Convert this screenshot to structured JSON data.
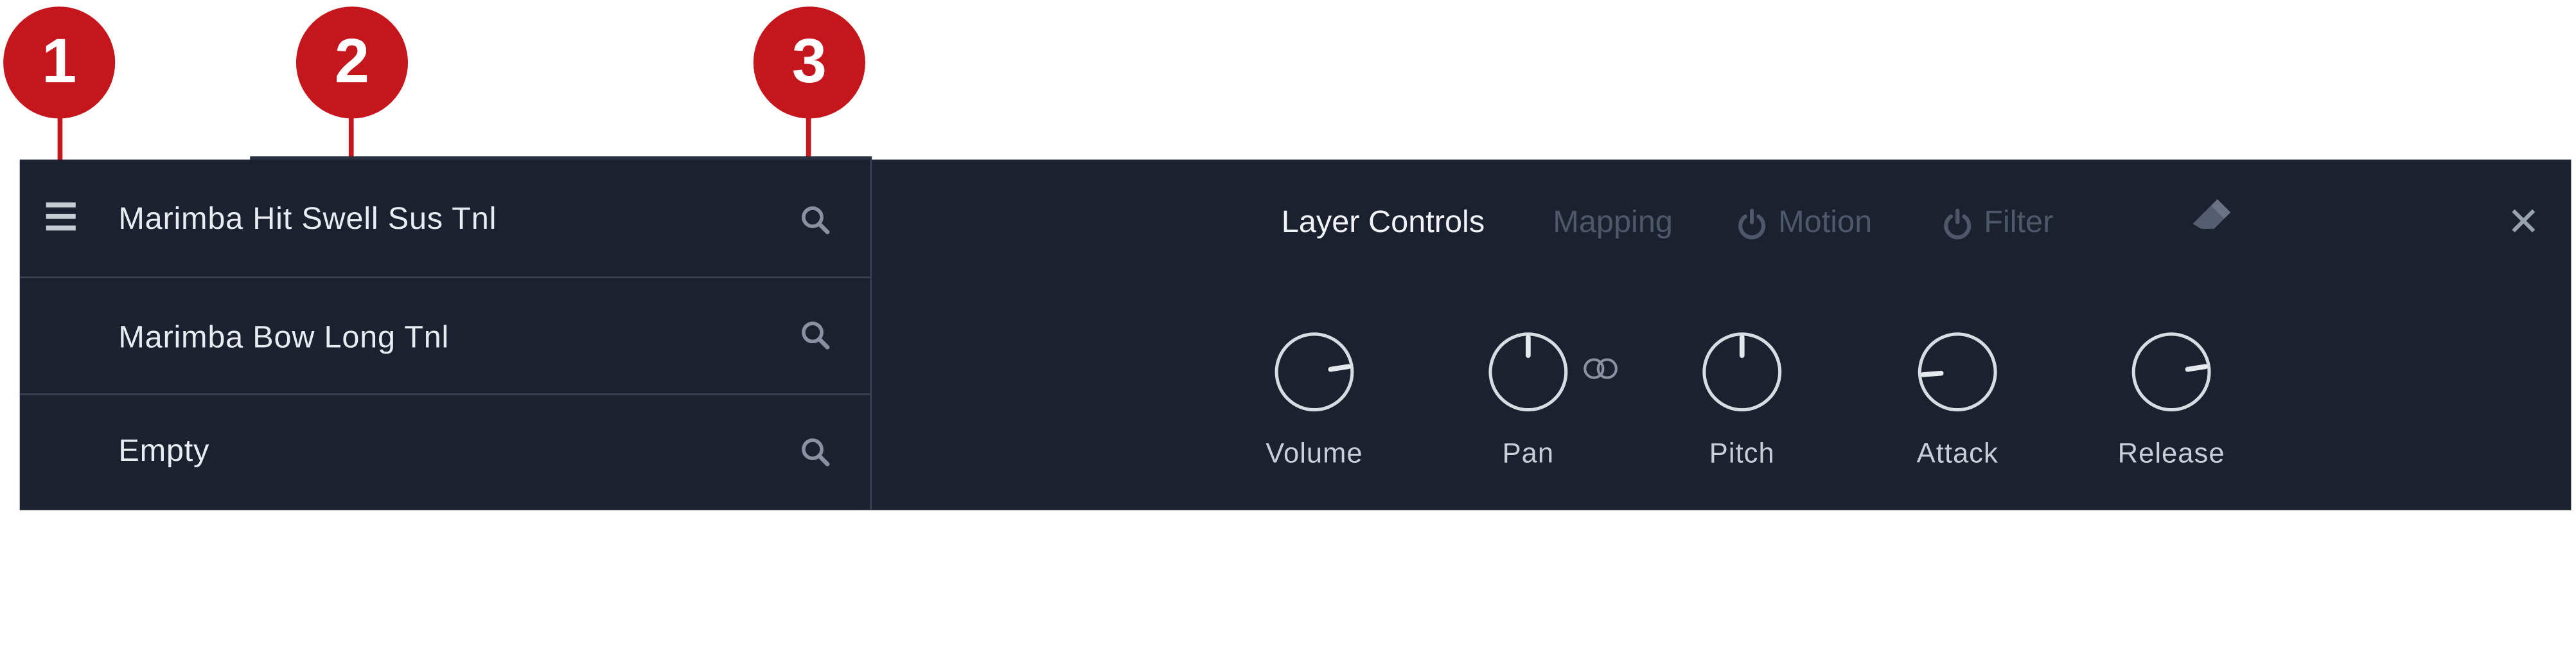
{
  "callouts": [
    {
      "number": "1"
    },
    {
      "number": "2"
    },
    {
      "number": "3"
    }
  ],
  "slots": [
    {
      "name": "Marimba Hit Swell Sus Tnl"
    },
    {
      "name": "Marimba Bow Long Tnl"
    },
    {
      "name": "Empty"
    }
  ],
  "tabs": {
    "layer_controls": "Layer Controls",
    "mapping": "Mapping",
    "motion": "Motion",
    "filter": "Filter"
  },
  "close_label": "✕",
  "knobs": [
    {
      "label": "Volume",
      "value": 0.8
    },
    {
      "label": "Pan",
      "value": 0.5
    },
    {
      "label": "Pitch",
      "value": 0.5
    },
    {
      "label": "Attack",
      "value": 0.15
    },
    {
      "label": "Release",
      "value": 0.8
    }
  ],
  "colors": {
    "callout": "#c4161c",
    "panel_bg": "#1c2130",
    "active_text": "#f1f3f7",
    "inactive_text": "#4f586b"
  },
  "icons": [
    "menu-icon",
    "search-icon",
    "power-icon",
    "eraser-icon",
    "close-icon",
    "link-icon"
  ]
}
